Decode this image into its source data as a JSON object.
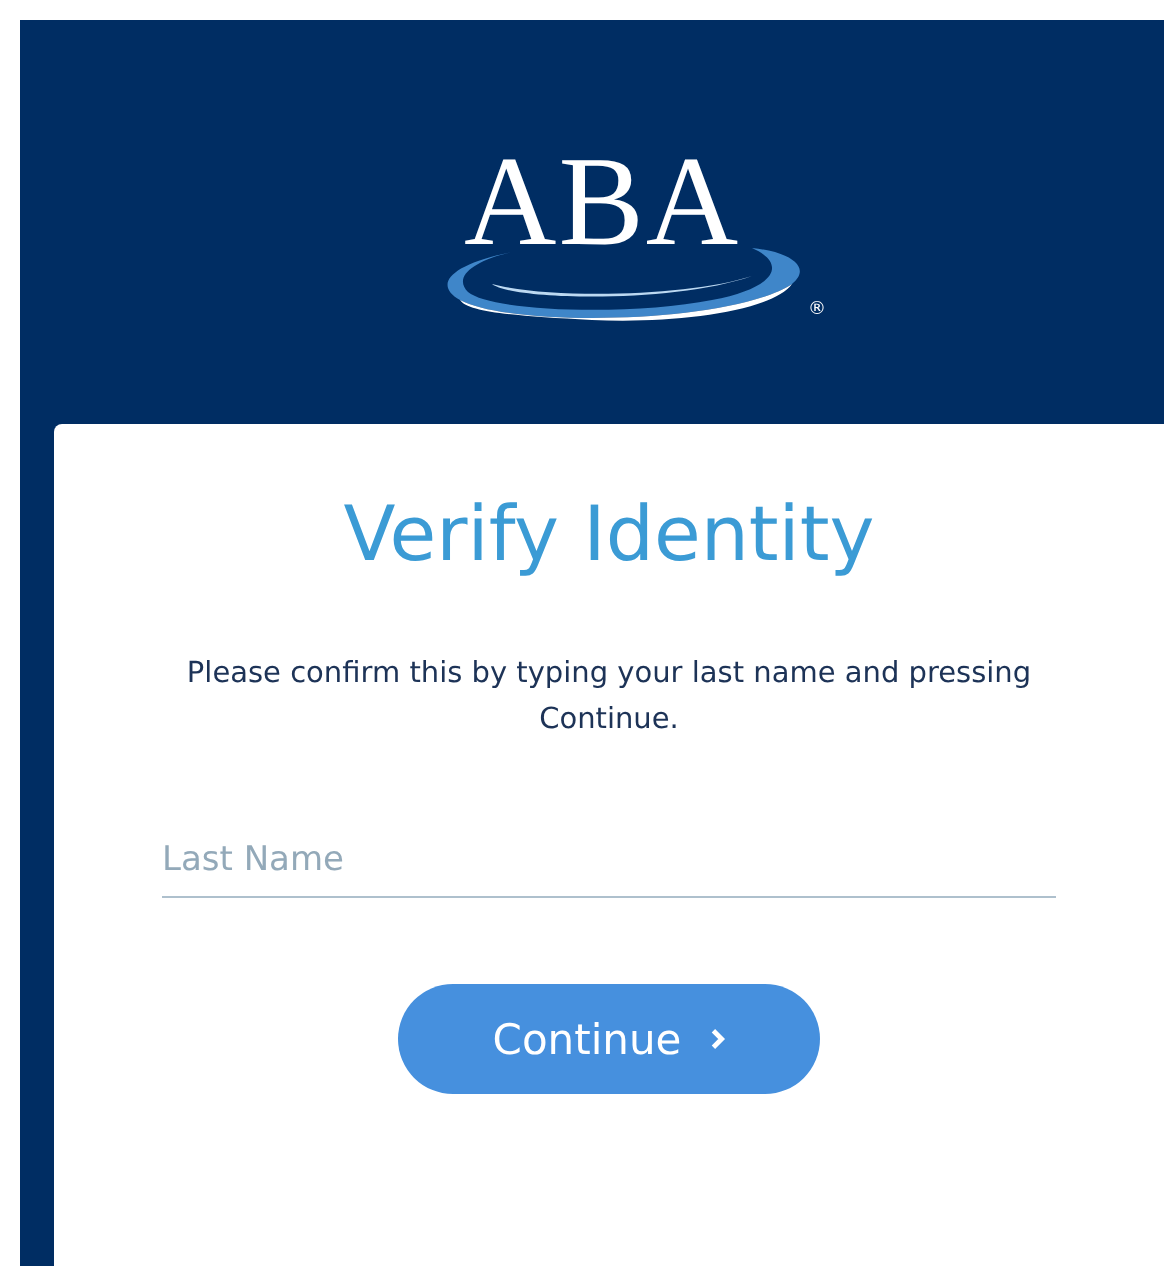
{
  "logo": {
    "text": "ABA",
    "mark": "®"
  },
  "card": {
    "title": "Verify Identity",
    "message": "Please confirm this by typing your last name and pressing Continue."
  },
  "field": {
    "placeholder": "Last Name"
  },
  "button": {
    "label": "Continue"
  }
}
